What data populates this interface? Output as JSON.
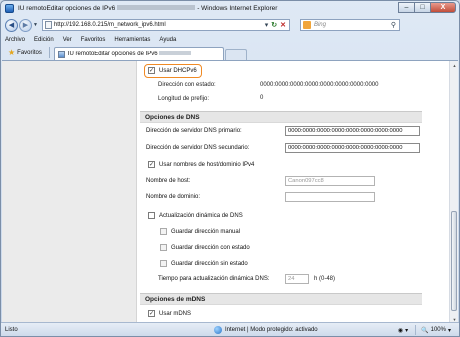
{
  "window": {
    "title_prefix": "IU remotoEditar opciones de IPv6",
    "title_suffix": "- Windows Internet Explorer",
    "minimize": "–",
    "maximize": "□",
    "close": "X"
  },
  "address": {
    "url": "http://192.168.0.215/m_network_ipv6.html",
    "search_placeholder": "Bing"
  },
  "menu": [
    "Archivo",
    "Edición",
    "Ver",
    "Favoritos",
    "Herramientas",
    "Ayuda"
  ],
  "tabs": {
    "favorites_label": "Favoritos",
    "active_tab_label": "IU remotoEditar opciones de IPv6"
  },
  "ipv6": {
    "use_dhcpv6_label": "Usar DHCPv6",
    "use_dhcpv6_checked": true,
    "stateful_address_label": "Dirección con estado:",
    "stateful_address_value": "0000:0000:0000:0000:0000:0000:0000:0000",
    "prefix_length_label": "Longitud de prefijo:",
    "prefix_length_value": "0"
  },
  "dns": {
    "section_title": "Opciones de DNS",
    "primary_label": "Dirección de servidor DNS primario:",
    "primary_value": "0000:0000:0000:0000:0000:0000:0000:0000",
    "secondary_label": "Dirección de servidor DNS secundario:",
    "secondary_value": "0000:0000:0000:0000:0000:0000:0000:0000",
    "use_ipv4_label": "Usar nombres de host/dominio IPv4",
    "use_ipv4_checked": true,
    "host_label": "Nombre de host:",
    "host_value": "Canon097cc8",
    "domain_label": "Nombre de dominio:",
    "domain_value": "",
    "dynamic_update_label": "Actualización dinámica de DNS",
    "dynamic_update_checked": false,
    "manual_label": "Guardar dirección manual",
    "stateful_label": "Guardar dirección con estado",
    "stateless_label": "Guardar dirección sin estado",
    "interval_label": "Tiempo para actualización dinámica DNS:",
    "interval_value": "24",
    "interval_unit": "h (0-48)"
  },
  "mdns": {
    "section_title": "Opciones de mDNS",
    "use_mdns_label": "Usar mDNS",
    "use_mdns_checked": true
  },
  "status": {
    "left": "Listo",
    "zone": "Internet | Modo protegido: activado",
    "zoom": "100%"
  },
  "colors": {
    "highlight": "#f08a24",
    "section_bg": "#e6e6e6",
    "left_pane": "#ebebeb"
  }
}
